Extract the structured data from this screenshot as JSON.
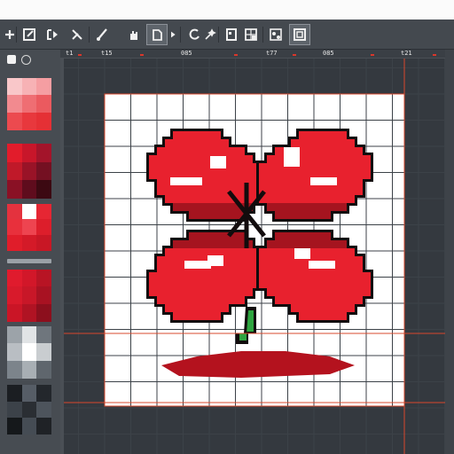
{
  "toolbar": {
    "tools": [
      {
        "icon": "plus-icon"
      },
      {
        "icon": "edit-box-icon"
      },
      {
        "icon": "bracket-arrow-icon"
      },
      {
        "icon": "scissors-icon"
      },
      {
        "icon": "brush-icon"
      },
      {
        "icon": "hand-icon"
      },
      {
        "icon": "page-icon"
      },
      {
        "icon": "play-icon"
      },
      {
        "icon": "lasso-icon"
      },
      {
        "icon": "wand-icon"
      },
      {
        "icon": "layer-icon"
      },
      {
        "icon": "grid-tool-icon"
      },
      {
        "icon": "transform-icon"
      },
      {
        "icon": "frame-icon"
      }
    ]
  },
  "ruler": {
    "labels": [
      "t1",
      "t15",
      "085",
      "t77",
      "085",
      "t21"
    ]
  },
  "palette": {
    "swatches": [
      {
        "name": "light-reds",
        "colors": [
          "#f9c7c9",
          "#f7b2b5",
          "#f59ea2",
          "#f28a8f",
          "#ef6e73",
          "#eb5a5f",
          "#ec4a4f",
          "#e8383d",
          "#e53035"
        ]
      },
      {
        "name": "dark-reds",
        "colors": [
          "#e21c2b",
          "#c8162a",
          "#a3142a",
          "#c01929",
          "#991327",
          "#741022",
          "#8a1125",
          "#5f0c1d",
          "#3c0912"
        ]
      },
      {
        "name": "bright-reds",
        "colors": [
          "#e4323e",
          "#ffffff",
          "#e62633",
          "#e8303c",
          "#ee4450",
          "#dd1e2b",
          "#e01d2a",
          "#d41a28",
          "#c81725"
        ]
      },
      {
        "name": "crimson",
        "colors": [
          "#e01b2d",
          "#d21729",
          "#b81424",
          "#d81a2b",
          "#c81728",
          "#a81222",
          "#ca1526",
          "#b01323",
          "#8c0f1d"
        ]
      },
      {
        "name": "light-greys",
        "colors": [
          "#9ca3a9",
          "#e1e4e6",
          "#6f767d",
          "#b9bec3",
          "#ffffff",
          "#c9cdd0",
          "#7c848b",
          "#a8afb4",
          "#5f666d"
        ]
      },
      {
        "name": "dark-greys",
        "colors": [
          "#1b1e22",
          "#565d66",
          "#23272c",
          "#3c4249",
          "#2a2e33",
          "#4d545c",
          "#15181b",
          "#454c54",
          "#1f2226"
        ]
      }
    ]
  },
  "colors": {
    "background": "#4a4f55",
    "canvas_frame": "#34393f",
    "canvas_white": "#ffffff",
    "grid_line": "#3c4248",
    "guide_line": "#d9482c",
    "petal_red": "#e8212e",
    "petal_dark": "#a5141f",
    "outline": "#120c0d",
    "stem_green": "#2fa540",
    "shadow_red": "#b4121e"
  }
}
